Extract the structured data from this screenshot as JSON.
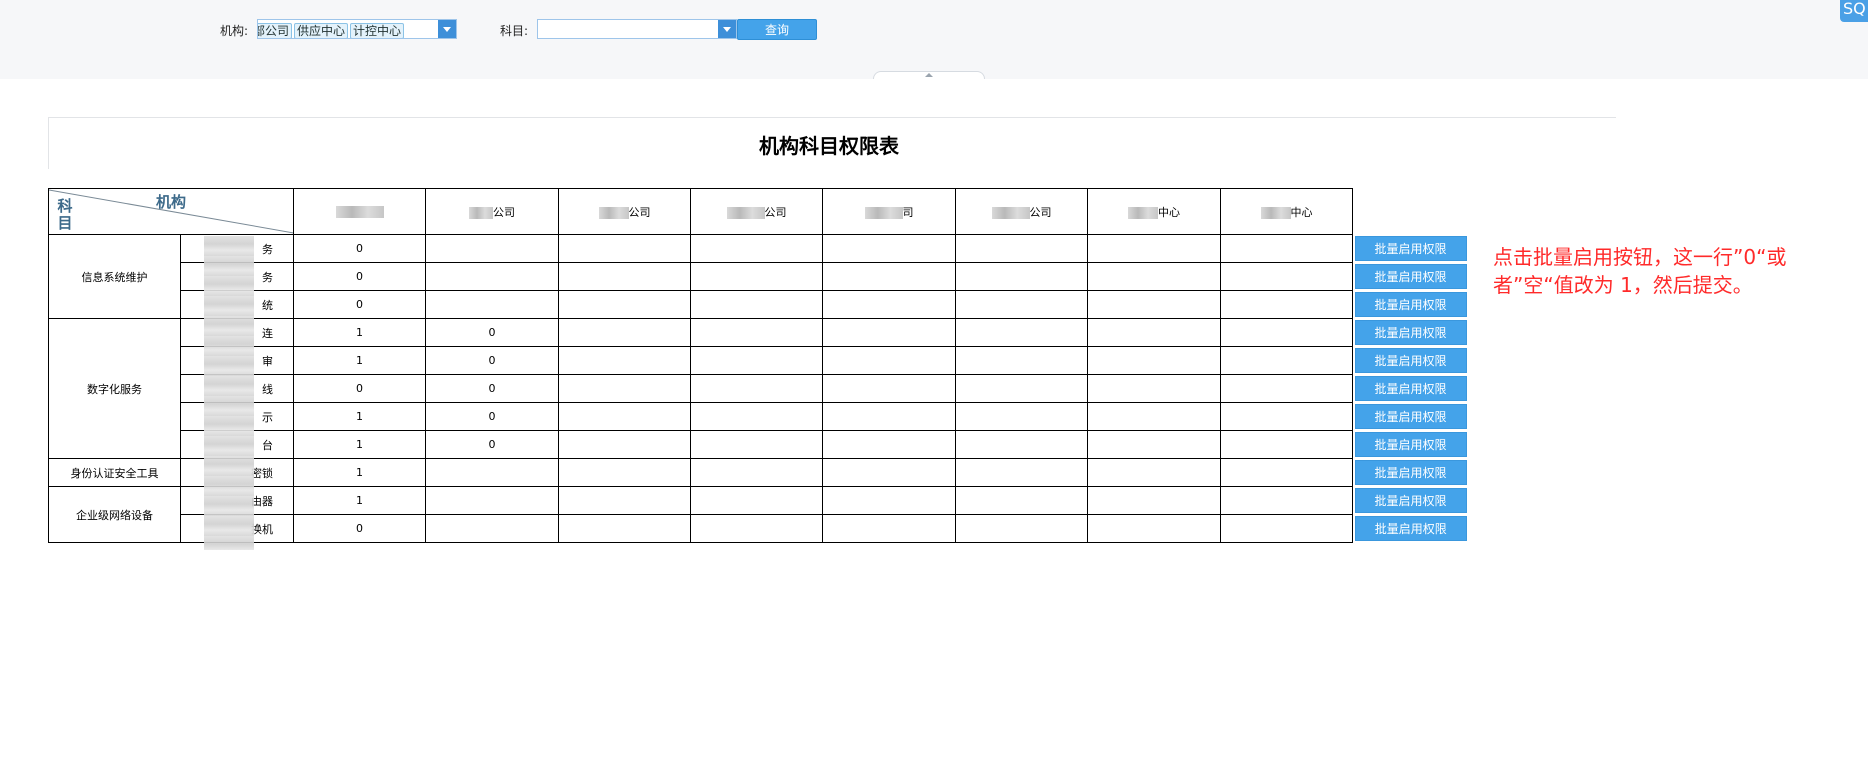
{
  "filters": {
    "org_label": "机构:",
    "org_tags": [
      "部公司",
      "供应中心",
      "计控中心"
    ],
    "subject_label": "科目:",
    "subject_value": "",
    "query_label": "查询"
  },
  "corner_badge": "SQ",
  "table": {
    "title": "机构科目权限表",
    "corner_org_label": "机构",
    "corner_subject_label": "科目",
    "columns": [
      "",
      "公司",
      "公司",
      "公司",
      "司",
      "公司",
      "中心",
      "中心"
    ],
    "groups": [
      {
        "name": "信息系统维护",
        "rows": [
          {
            "sub": "务",
            "values": [
              "0",
              "",
              "",
              "",
              "",
              "",
              "",
              ""
            ]
          },
          {
            "sub": "务",
            "values": [
              "0",
              "",
              "",
              "",
              "",
              "",
              "",
              ""
            ]
          },
          {
            "sub": "统",
            "values": [
              "0",
              "",
              "",
              "",
              "",
              "",
              "",
              ""
            ]
          }
        ]
      },
      {
        "name": "数字化服务",
        "rows": [
          {
            "sub": "连",
            "values": [
              "1",
              "0",
              "",
              "",
              "",
              "",
              "",
              ""
            ]
          },
          {
            "sub": "审",
            "values": [
              "1",
              "0",
              "",
              "",
              "",
              "",
              "",
              ""
            ]
          },
          {
            "sub": "线",
            "values": [
              "0",
              "0",
              "",
              "",
              "",
              "",
              "",
              ""
            ]
          },
          {
            "sub": "示",
            "values": [
              "1",
              "0",
              "",
              "",
              "",
              "",
              "",
              ""
            ]
          },
          {
            "sub": "台",
            "values": [
              "1",
              "0",
              "",
              "",
              "",
              "",
              "",
              ""
            ]
          }
        ]
      },
      {
        "name": "身份认证安全工具",
        "rows": [
          {
            "sub": "密锁",
            "values": [
              "1",
              "",
              "",
              "",
              "",
              "",
              "",
              ""
            ]
          }
        ]
      },
      {
        "name": "企业级网络设备",
        "rows": [
          {
            "sub": "由器",
            "values": [
              "1",
              "",
              "",
              "",
              "",
              "",
              "",
              ""
            ]
          },
          {
            "sub": "换机",
            "values": [
              "0",
              "",
              "",
              "",
              "",
              "",
              "",
              ""
            ]
          }
        ]
      }
    ],
    "batch_button_label": "批量启用权限"
  },
  "annotation": "点击批量启用按钮，这一行”0“或者”空“值改为 1，然后提交。",
  "colors": {
    "primary_button": "#44a3ea",
    "note_red": "#ff2a2a",
    "header_text": "#3d6a8a"
  }
}
